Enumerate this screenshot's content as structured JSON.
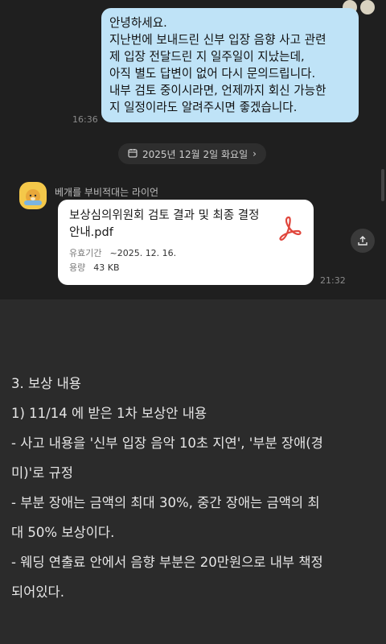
{
  "chat": {
    "outgoing_message": "안녕하세요.\n지난번에 보내드린 신부 입장 음향 사고 관련\n제 입장 전달드린 지 일주일이 지났는데,\n아직 별도 답변이 없어 다시 문의드립니다.\n내부 검토 중이시라면, 언제까지 회신 가능한\n지 일정이라도 알려주시면 좋겠습니다.",
    "outgoing_time": "16:36",
    "date_divider": "2025년 12월 2일 화요일",
    "sender_name": "베개를 부비적대는 라이언",
    "file": {
      "title": "보상심의위원회 검토 결과 및 최종 결정 안내.pdf",
      "expiry_label": "유효기간",
      "expiry_value": "~2025. 12. 16.",
      "size_label": "용량",
      "size_value": "43 KB"
    },
    "incoming_time": "21:32",
    "icons": [
      "calendar-icon",
      "chevron-right-icon",
      "pdf-icon",
      "share-icon",
      "avatar"
    ]
  },
  "article": {
    "lines": [
      "3. 보상 내용",
      "1) 11/14 에 받은 1차 보상안 내용",
      "- 사고 내용을 '신부 입장 음악 10초 지연', '부분 장애(경",
      "미)'로 규정",
      "- 부분 장애는 금액의 최대 30%, 중간 장애는 금액의 최",
      "대 50% 보상이다.",
      "- 웨딩 연출료 안에서 음향 부분은 20만원으로 내부 책정",
      "되어있다."
    ]
  },
  "colors": {
    "outgoing_bubble": "#bfe3f7",
    "chat_bg": "#1f1f1f",
    "article_bg": "#2b2b2b",
    "pdf_accent": "#e0463c"
  }
}
